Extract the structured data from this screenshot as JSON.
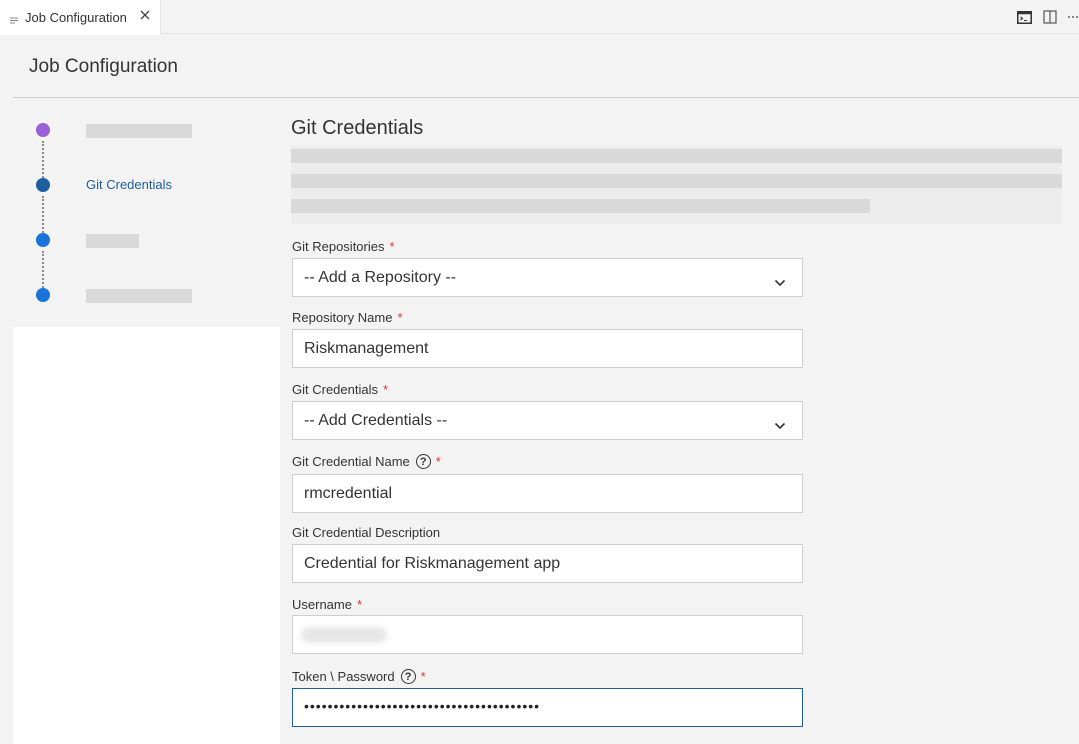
{
  "tab": {
    "label": "Job Configuration"
  },
  "header": {
    "title": "Job Configuration"
  },
  "stepper": {
    "steps": [
      {
        "label": "",
        "color": "#9b5fd6",
        "redacted": true
      },
      {
        "label": "Git Credentials",
        "color": "#1f5da1",
        "active": true
      },
      {
        "label": "",
        "color": "#1a73d9",
        "redacted": true
      },
      {
        "label": "",
        "color": "#1a73d9",
        "redacted": true
      }
    ]
  },
  "section": {
    "title": "Git Credentials"
  },
  "form": {
    "git_repositories": {
      "label": "Git Repositories",
      "required": "*",
      "value": "-- Add a Repository --"
    },
    "repository_name": {
      "label": "Repository Name",
      "required": "*",
      "value": "Riskmanagement"
    },
    "git_credentials": {
      "label": "Git Credentials",
      "required": "*",
      "value": "-- Add Credentials --"
    },
    "git_credential_name": {
      "label": "Git Credential Name",
      "help": "?",
      "required": "*",
      "value": "rmcredential"
    },
    "git_credential_description": {
      "label": "Git Credential Description",
      "value": "Credential for Riskmanagement app"
    },
    "username": {
      "label": "Username",
      "required": "*"
    },
    "token_password": {
      "label": "Token \\ Password",
      "help": "?",
      "required": "*",
      "value": "••••••••••••••••••••••••••••••••••••••••"
    }
  },
  "colors": {
    "accent": "#1f5da1",
    "required": "#e0332d",
    "step_purple": "#9b5fd6",
    "step_blue": "#1a73d9"
  },
  "icons": [
    "document-icon",
    "close-icon",
    "terminal-icon",
    "split-editor-icon",
    "more-icon",
    "chevron-down-icon",
    "help-icon"
  ]
}
